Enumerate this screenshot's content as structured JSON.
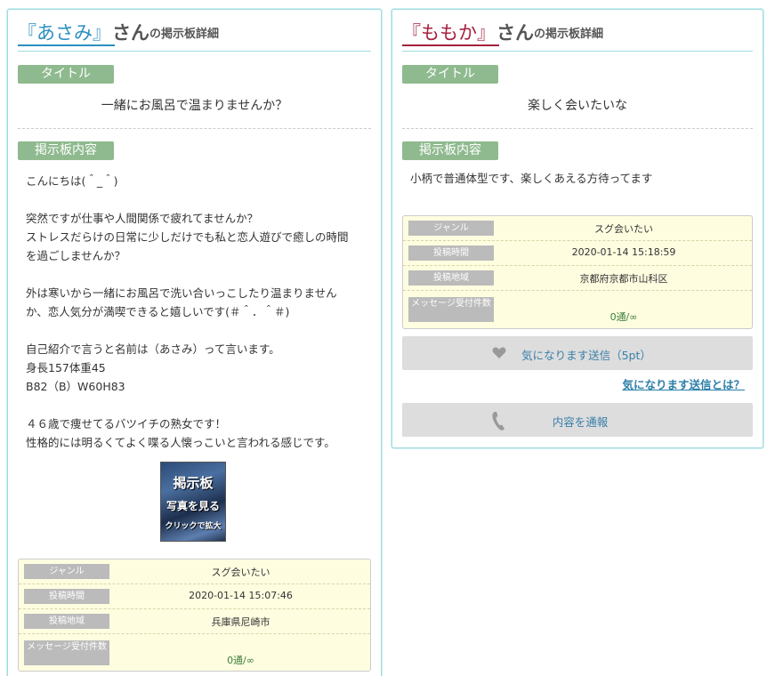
{
  "left": {
    "name": "『あさみ』",
    "san": "さん",
    "suffix": "の掲示板詳細",
    "title_label": "タイトル",
    "title": "一緒にお風呂で温まりませんか？",
    "content_label": "掲示板内容",
    "content_lines": [
      "こんにちは(＾_＾)",
      "",
      "突然ですが仕事や人間関係で疲れてませんか？",
      "ストレスだらけの日常に少しだけでも私と恋人遊びで癒しの時間",
      "を過ごしませんか？",
      "",
      "外は寒いから一緒にお風呂で洗い合いっこしたり温まりません",
      "か、恋人気分が満喫できると嬉しいです(＃＾．＾＃)",
      "",
      "自己紹介で言うと名前は（あさみ）って言います。",
      "身長157体重45",
      "B82（B）W60H83",
      "",
      "４６歳で痩せてるバツイチの熟女です！",
      "性格的には明るくてよく喋る人懐っこいと言われる感じです。"
    ],
    "photo": {
      "line1": "掲示板",
      "line2": "写真を見る",
      "line3": "クリックで拡大"
    },
    "info": [
      {
        "key": "ジャンル",
        "value": "スグ会いたい"
      },
      {
        "key": "投稿時間",
        "value": "2020-01-14 15:07:46"
      },
      {
        "key": "投稿地域",
        "value": "兵庫県尼崎市"
      },
      {
        "key": "メッセージ受付件数",
        "value": "0通/∞"
      }
    ]
  },
  "right": {
    "name": "『ももか』",
    "san": "さん",
    "suffix": "の掲示板詳細",
    "title_label": "タイトル",
    "title": "楽しく会いたいな",
    "content_label": "掲示板内容",
    "content_lines": [
      "小柄で普通体型です、楽しくあえる方待ってます"
    ],
    "info": [
      {
        "key": "ジャンル",
        "value": "スグ会いたい"
      },
      {
        "key": "投稿時間",
        "value": "2020-01-14 15:18:59"
      },
      {
        "key": "投稿地域",
        "value": "京都府京都市山科区"
      },
      {
        "key": "メッセージ受付件数",
        "value": "0通/∞"
      }
    ],
    "like_button": "気になります送信（5pt）",
    "like_help_link": "気になります送信とは？",
    "report_button": "内容を通報"
  },
  "colors": {
    "accent_blue": "#2b8fc0",
    "accent_red": "#a5203e",
    "label_green": "#8fba8f",
    "info_bg": "#fffde0",
    "panel_border": "#9fdcdf"
  },
  "icons": [
    "heart-icon",
    "phone-icon"
  ]
}
